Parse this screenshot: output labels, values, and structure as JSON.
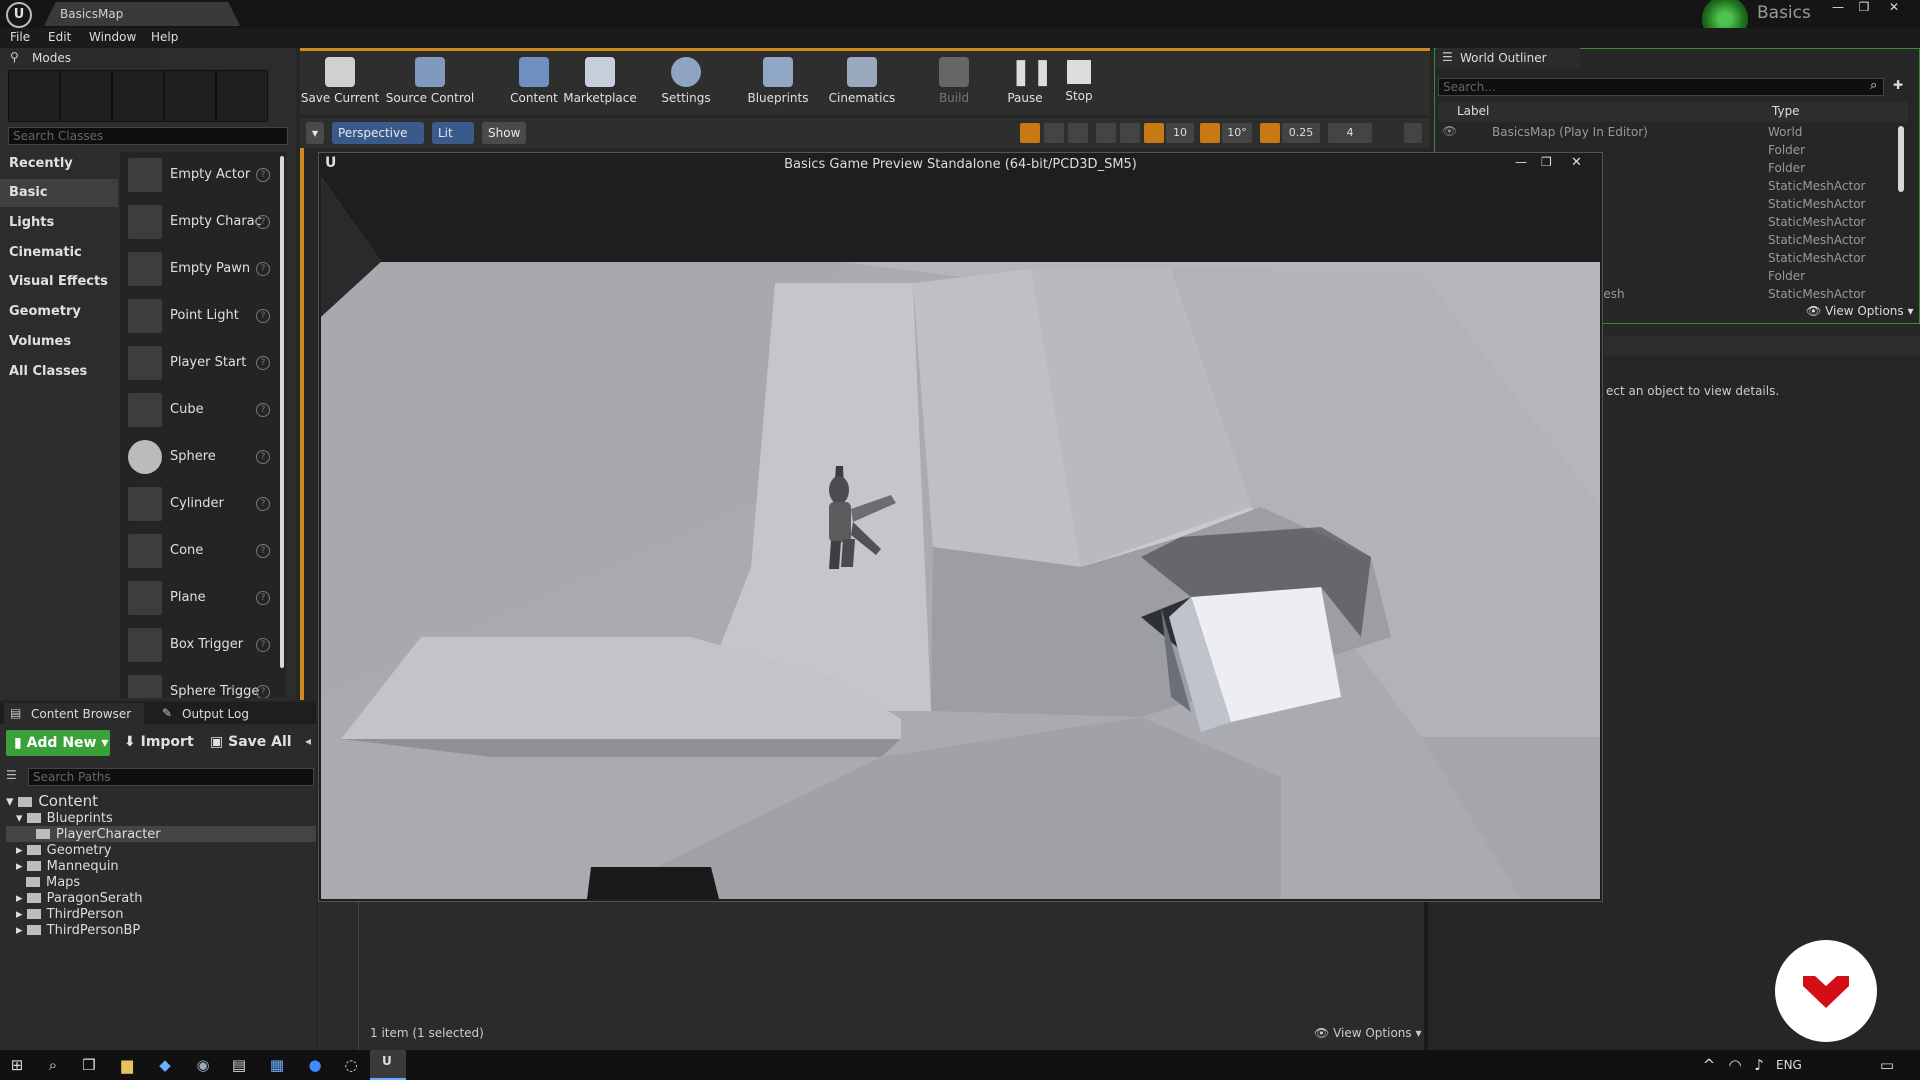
{
  "window": {
    "tab_title": "BasicsMap",
    "project_name": "Basics"
  },
  "menu": [
    "File",
    "Edit",
    "Window",
    "Help"
  ],
  "modes": {
    "tab_label": "Modes",
    "search_placeholder": "Search Classes",
    "categories": [
      "Recently Placed",
      "Basic",
      "Lights",
      "Cinematic",
      "Visual Effects",
      "Geometry",
      "Volumes",
      "All Classes"
    ],
    "selected_category": "Basic",
    "items": [
      "Empty Actor",
      "Empty Charac",
      "Empty Pawn",
      "Point Light",
      "Player Start",
      "Cube",
      "Sphere",
      "Cylinder",
      "Cone",
      "Plane",
      "Box Trigger",
      "Sphere Trigge"
    ]
  },
  "toolbar": {
    "buttons": [
      "Save Current",
      "Source Control",
      "Content",
      "Marketplace",
      "Settings",
      "Blueprints",
      "Cinematics",
      "Build",
      "Pause",
      "Stop"
    ]
  },
  "viewport": {
    "perspective": "Perspective",
    "lit": "Lit",
    "show": "Show",
    "grid_snap": "10",
    "rot_snap": "10°",
    "scale_snap": "0.25",
    "cam_speed": "4"
  },
  "game_window": {
    "title": "Basics Game Preview Standalone (64-bit/PCD3D_SM5)"
  },
  "outliner": {
    "tab_label": "World Outliner",
    "search_placeholder": "Search...",
    "col_label": "Label",
    "col_type": "Type",
    "first_row_label": "BasicsMap (Play In Editor)",
    "types": [
      "World",
      "Folder",
      "Folder",
      "StaticMeshActor",
      "StaticMeshActor",
      "StaticMeshActor",
      "StaticMeshActor",
      "StaticMeshActor",
      "Folder",
      "StaticMeshActor"
    ],
    "partial_label": "lesh",
    "view_options": "View Options"
  },
  "details": {
    "hint": "ect an object to view details."
  },
  "content_browser": {
    "tab1": "Content Browser",
    "tab2": "Output Log",
    "add_new": "Add New",
    "import": "Import",
    "save_all": "Save All",
    "search_placeholder": "Search Paths",
    "root": "Content",
    "folders": [
      "Blueprints",
      "PlayerCharacter",
      "Geometry",
      "Mannequin",
      "Maps",
      "ParagonSerath",
      "ThirdPerson",
      "ThirdPersonBP"
    ],
    "selected_folder": "PlayerCharacter",
    "status": "1 item (1 selected)",
    "view_options": "View Options"
  },
  "taskbar": {
    "lang": "ENG"
  }
}
